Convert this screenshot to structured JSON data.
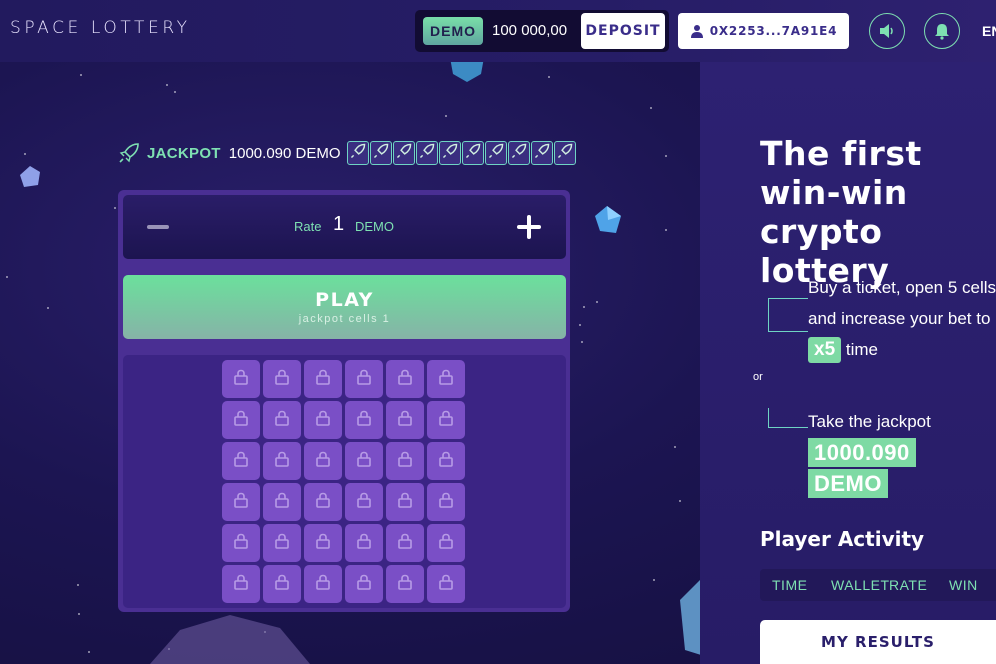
{
  "header": {
    "logo": "SPACE LOTTERY",
    "demo_badge": "DEMO",
    "balance": "100 000,00",
    "deposit_label": "DEPOSIT",
    "wallet_address": "0X2253...7A91E4",
    "language": "EN"
  },
  "icons": {
    "user": "user-icon",
    "sound": "speaker-icon",
    "notifications": "bell-icon",
    "rocket": "rocket-icon",
    "lock": "lock-icon"
  },
  "game": {
    "jackpot_label": "JACKPOT",
    "jackpot_value": "1000.090 DEMO",
    "jackpot_cells_count": 10,
    "rate_label": "Rate",
    "rate_value": "1",
    "rate_unit": "DEMO",
    "play_label": "PLAY",
    "play_sub": "jackpot cells 1",
    "grid_rows": 6,
    "grid_cols": 6
  },
  "promo": {
    "title": "The first win-win crypto lottery",
    "offer_prefix": "Buy a ticket, open 5 cells and increase your bet to",
    "offer_badge": "x5",
    "offer_suffix": "time",
    "or": "or",
    "take_jackpot": "Take the jackpot",
    "jackpot_amount": "1000.090 DEMO"
  },
  "activity": {
    "title": "Player Activity",
    "columns": [
      "TIME",
      "WALLET",
      "RATE",
      "WIN"
    ],
    "my_results": "MY RESULTS"
  },
  "colors": {
    "accent_green": "#7ee0b2",
    "background": "#1c1552",
    "cell_purple": "#7a4fc6"
  }
}
